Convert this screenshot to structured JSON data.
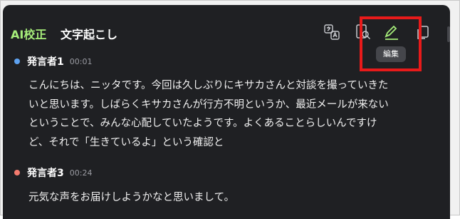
{
  "header": {
    "ai_label": "AI校正",
    "title": "文字起こし"
  },
  "toolbar": {
    "icons": [
      "translate-icon",
      "search-doc-icon",
      "edit-icon",
      "copy-icon"
    ],
    "tooltip": "編集"
  },
  "transcript": [
    {
      "speaker": "発言者1",
      "time": "00:01",
      "color": "#5ea2f0",
      "lines": [
        "こんにちは、ニッタです。今回は久しぶりにキサカさんと対談を撮っていきた",
        "いと思います。しばらくキサカさんが行方不明というか、最近メールが来ない",
        "ということで、みんな心配していたようです。よくあることらしいんですけ",
        "ど、それで「生きているよ」という確認と"
      ]
    },
    {
      "speaker": "発言者3",
      "time": "00:24",
      "color": "#f47b6e",
      "lines": [
        "元気な声をお届けしようかなと思いまして。"
      ]
    }
  ]
}
